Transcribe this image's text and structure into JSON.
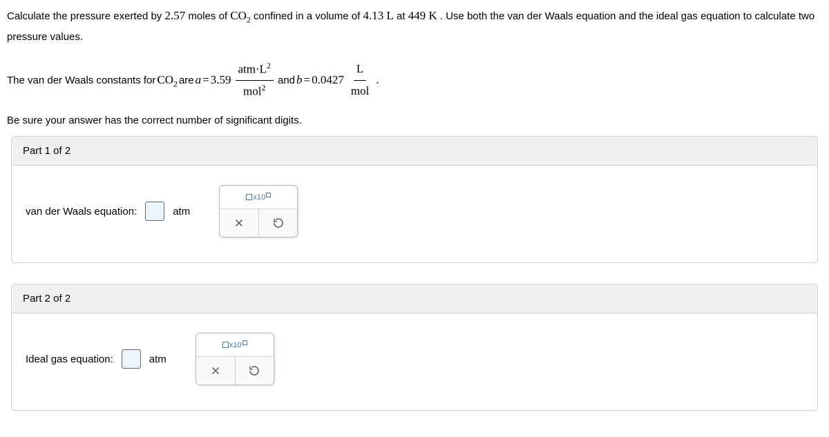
{
  "question": {
    "intro_pre": "Calculate the pressure exerted by ",
    "moles": "2.57",
    "intro_mid1": " moles of ",
    "gas": "CO",
    "gas_sub": "2",
    "intro_mid2": " confined in a volume of ",
    "volume": "4.13 L",
    "intro_mid3": " at ",
    "temp": "449 K",
    "intro_tail": ". Use both the van der Waals equation and the ideal gas equation to calculate two pressure values."
  },
  "constants": {
    "pre": "The van der Waals constants for ",
    "gas": "CO",
    "gas_sub": "2",
    "are": " are ",
    "a_label": "a",
    "eq1": "=",
    "a_val": "3.59",
    "frac1_num_a": "atm·L",
    "frac1_num_sup": "2",
    "frac1_den_a": "mol",
    "frac1_den_sup": "2",
    "and": " and ",
    "b_label": "b",
    "eq2": "=",
    "b_val": "0.0427",
    "frac2_num": "L",
    "frac2_den": "mol",
    "period": "."
  },
  "sig_digits": "Be sure your answer has the correct number of significant digits.",
  "parts": {
    "p1_header": "Part 1 of 2",
    "p1_label": "van der Waals equation:",
    "p1_unit": "atm",
    "p2_header": "Part 2 of 2",
    "p2_label": "Ideal gas equation:",
    "p2_unit": "atm",
    "sci_text": "x10"
  }
}
